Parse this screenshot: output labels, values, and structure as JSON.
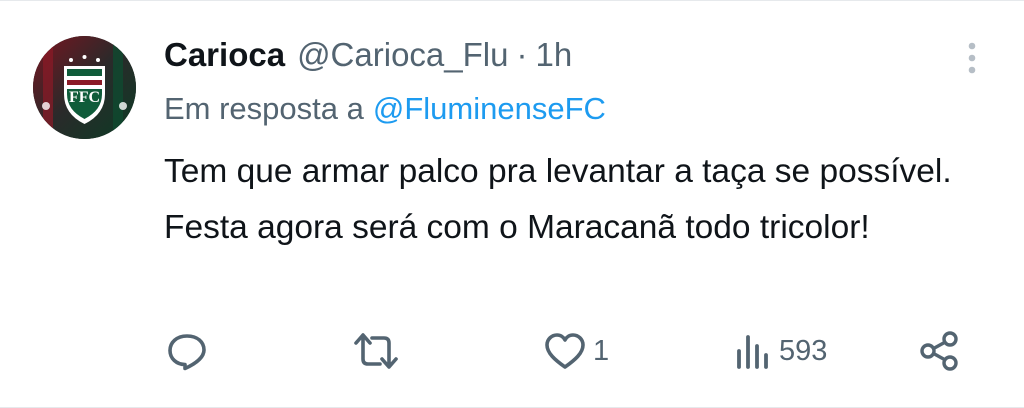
{
  "tweet": {
    "display_name": "Carioca",
    "handle": "@Carioca_Flu",
    "separator": "·",
    "time": "1h",
    "reply_prefix": "Em resposta a",
    "reply_to": "@FluminenseFC",
    "text": "Tem que armar palco pra levantar a taça se possível. Festa agora será com o Maracanã todo tricolor!",
    "avatar_icon": "fluminense-crest-icon"
  },
  "actions": {
    "reply": {
      "icon": "reply-icon"
    },
    "retweet": {
      "icon": "retweet-icon"
    },
    "like": {
      "icon": "heart-icon",
      "count": "1"
    },
    "views": {
      "icon": "views-icon",
      "count": "593"
    },
    "share": {
      "icon": "share-icon"
    }
  },
  "more_icon": "more-vertical-icon",
  "colors": {
    "text_primary": "#0f1419",
    "text_secondary": "#536471",
    "link": "#1d9bf0",
    "icon": "#536471"
  }
}
